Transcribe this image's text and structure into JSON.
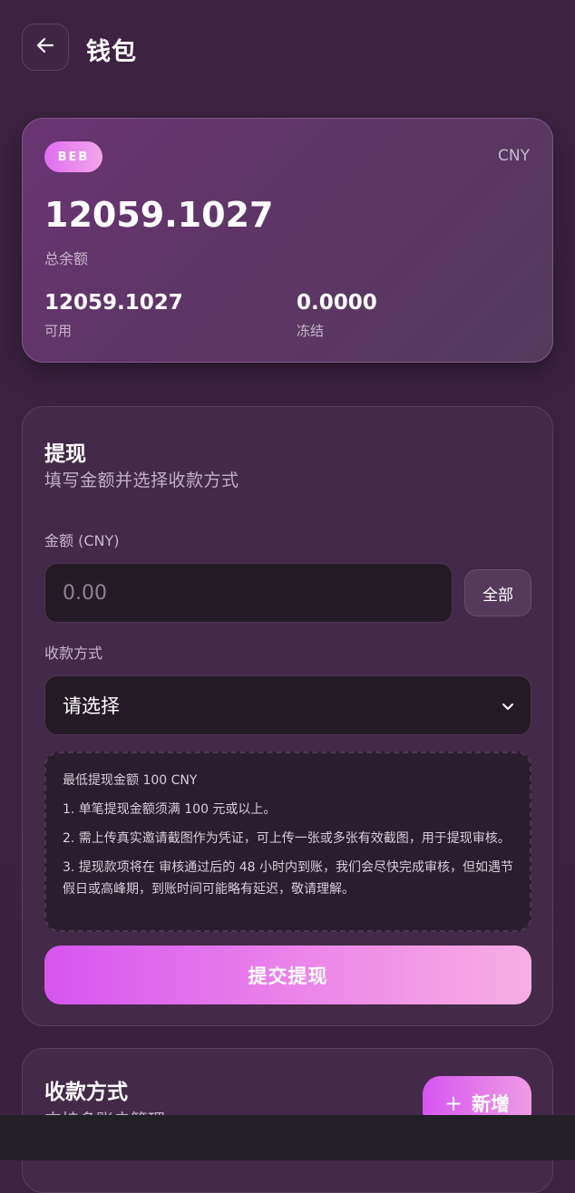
{
  "header": {
    "title": "钱包"
  },
  "balance": {
    "badge": "BEB",
    "currency": "CNY",
    "total_amount": "12059.1027",
    "total_label": "总余额",
    "available_amount": "12059.1027",
    "available_label": "可用",
    "frozen_amount": "0.0000",
    "frozen_label": "冻结"
  },
  "withdraw": {
    "title": "提现",
    "subtitle": "填写金额并选择收款方式",
    "amount_label": "金额 (CNY)",
    "amount_placeholder": "0.00",
    "all_button": "全部",
    "method_label": "收款方式",
    "method_value": "请选择",
    "notice": {
      "min": "最低提现金额 100 CNY",
      "rule1": "1. 单笔提现金额须满 100 元或以上。",
      "rule2": "2. 需上传真实邀请截图作为凭证，可上传一张或多张有效截图，用于提现审核。",
      "rule3": "3. 提现款项将在 审核通过后的 48 小时内到账，我们会尽快完成审核，但如遇节假日或高峰期，到账时间可能略有延迟，敬请理解。"
    },
    "submit_button": "提交提现"
  },
  "payment_methods": {
    "title": "收款方式",
    "subtitle": "支持多账户管理",
    "add_button": "新增"
  },
  "icons": {
    "back": "arrow-left-icon",
    "dropdown": "chevron-down-icon",
    "add": "plus-icon"
  },
  "colors": {
    "background": "#3a2240",
    "accent_start": "#d655f0",
    "accent_end": "#f7aee4"
  }
}
